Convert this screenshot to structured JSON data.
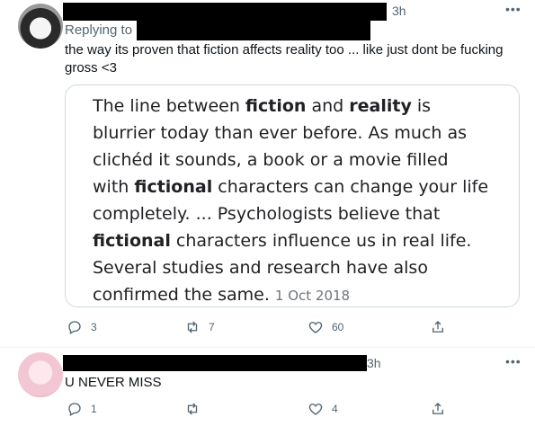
{
  "tweet1": {
    "time": "3h",
    "replying_to_label": "Replying to",
    "text_line1": "the way its proven that fiction affects reality too ... like just dont be fucking",
    "text_line2": "gross <3",
    "quote": {
      "line1_a": "The line between ",
      "line1_b": "fiction",
      "line1_c": " and ",
      "line1_d": "reality",
      "line1_e": " is",
      "line2": "blurrier today than ever before. As much as",
      "line3": "clichéd it sounds, a book or a movie filled",
      "line4_a": "with ",
      "line4_b": "fictional",
      "line4_c": " characters can change your life",
      "line5": "completely. ... Psychologists believe that",
      "line6_a": "fictional",
      "line6_b": " characters influence us in real life.",
      "line7": "Several studies and research have also",
      "line8": "confirmed the same.",
      "date": "1 Oct 2018"
    },
    "actions": {
      "replies": "3",
      "retweets": "7",
      "likes": "60"
    }
  },
  "tweet2": {
    "time": "3h",
    "text": "U NEVER MISS",
    "actions": {
      "replies": "1",
      "likes": "4"
    }
  },
  "colors": {
    "secondary_text": "#536471",
    "border": "#cfd9de"
  }
}
